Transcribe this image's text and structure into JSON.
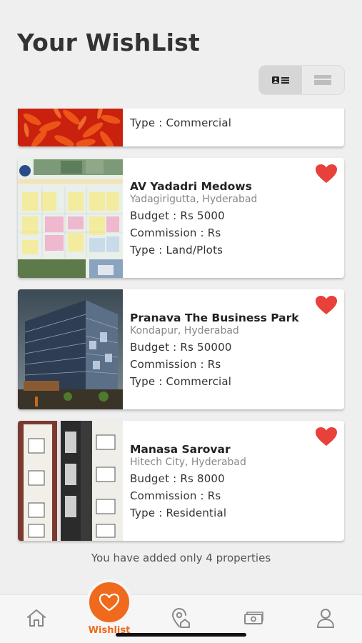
{
  "header": {
    "title": "Your WishList"
  },
  "view_toggle": {
    "options": [
      "card-view-icon",
      "list-view-icon"
    ],
    "selected": "card-view-icon"
  },
  "properties": [
    {
      "name": "",
      "location": "",
      "budget": "",
      "commission": "",
      "type": "Type : Commercial",
      "image": "red-flower-photo",
      "wishlisted": true
    },
    {
      "name": "AV Yadadri Medows",
      "location": "Yadagirigutta, Hyderabad",
      "budget": "Budget : Rs 5000",
      "commission": "Commission : Rs",
      "type": "Type : Land/Plots",
      "image": "plot-layout-map",
      "wishlisted": true
    },
    {
      "name": "Pranava The Business Park",
      "location": "Kondapur, Hyderabad",
      "budget": "Budget : Rs 50000",
      "commission": "Commission : Rs",
      "type": "Type : Commercial",
      "image": "glass-office-tower",
      "wishlisted": true
    },
    {
      "name": "Manasa Sarovar",
      "location": "Hitech City, Hyderabad",
      "budget": "Budget : Rs 8000",
      "commission": "Commission : Rs",
      "type": "Type : Residential",
      "image": "residential-apartment",
      "wishlisted": true
    }
  ],
  "footer_note": "You have added only 4 properties",
  "tabbar": {
    "items": [
      {
        "icon": "home-icon",
        "label": ""
      },
      {
        "icon": "heart-icon",
        "label": "Wishlist",
        "active": true
      },
      {
        "icon": "location-home-icon",
        "label": ""
      },
      {
        "icon": "money-icon",
        "label": ""
      },
      {
        "icon": "user-icon",
        "label": ""
      }
    ]
  },
  "colors": {
    "accent": "#ef6a1c",
    "heart": "#e8403a",
    "background": "#efefef"
  }
}
